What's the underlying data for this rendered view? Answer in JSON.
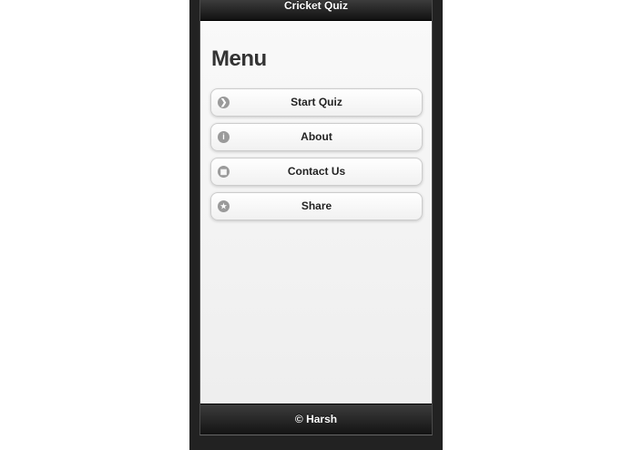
{
  "header": {
    "title": "Cricket Quiz"
  },
  "menu": {
    "title": "Menu",
    "items": [
      {
        "label": "Start Quiz",
        "icon": "arrow-right-icon",
        "glyph": "❯"
      },
      {
        "label": "About",
        "icon": "info-icon",
        "glyph": "i"
      },
      {
        "label": "Contact Us",
        "icon": "grid-icon",
        "glyph": "▦"
      },
      {
        "label": "Share",
        "icon": "star-icon",
        "glyph": "★"
      }
    ]
  },
  "footer": {
    "text": "© Harsh"
  },
  "colors": {
    "bar": "#1f1f1f",
    "content_bg": "#f3f3f3",
    "icon_bg": "#9a9a9a"
  }
}
